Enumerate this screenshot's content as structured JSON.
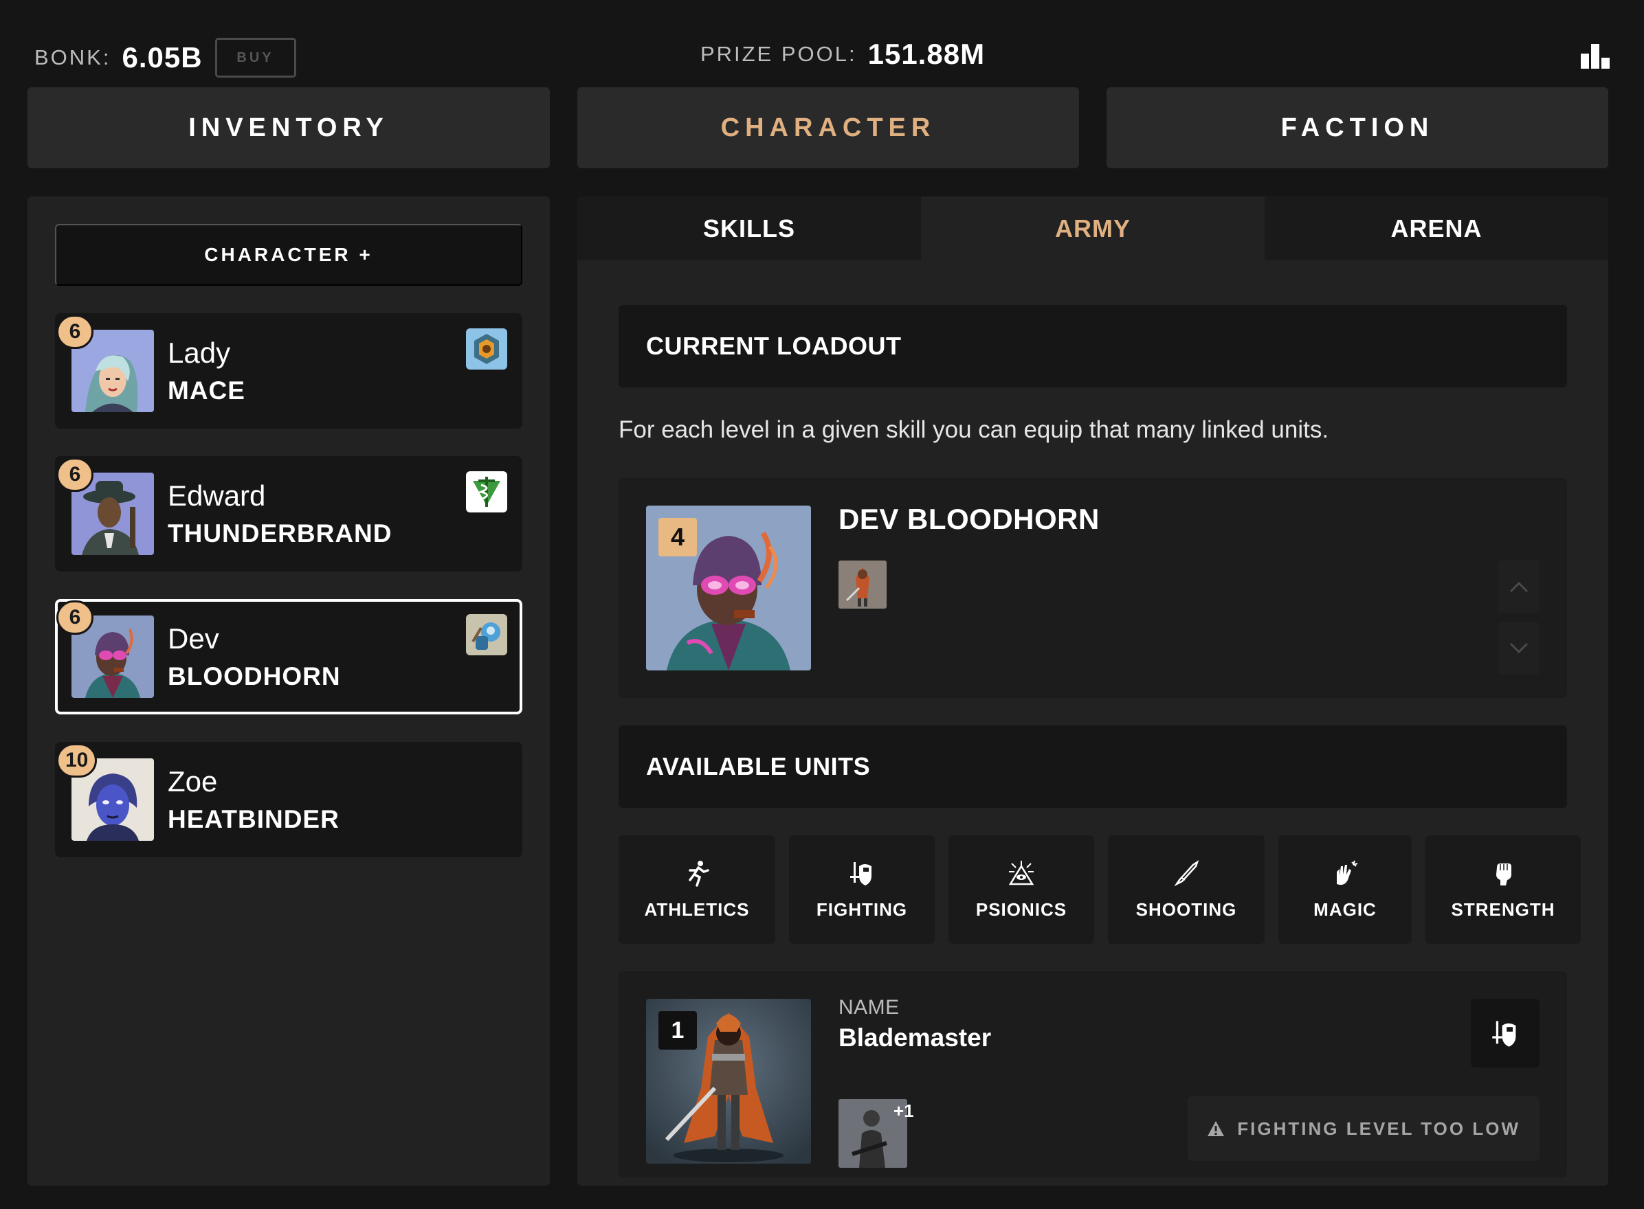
{
  "header": {
    "bonk_label": "BONK:",
    "bonk_value": "6.05B",
    "buy_label": "BUY",
    "prize_label": "PRIZE POOL:",
    "prize_value": "151.88M",
    "stats_icon": "bar-chart-icon"
  },
  "main_tabs": {
    "inventory": "INVENTORY",
    "character": "CHARACTER",
    "faction": "FACTION",
    "active": "CHARACTER"
  },
  "left": {
    "add_character_label": "CHARACTER +",
    "characters": [
      {
        "level": "6",
        "first": "Lady",
        "last": "MACE",
        "faction_icon": "hexagon-crest-icon",
        "selected": false
      },
      {
        "level": "6",
        "first": "Edward",
        "last": "THUNDERBRAND",
        "faction_icon": "green-caduceus-icon",
        "selected": false
      },
      {
        "level": "6",
        "first": "Dev",
        "last": "BLOODHORN",
        "faction_icon": "blue-robot-icon",
        "selected": true
      },
      {
        "level": "10",
        "first": "Zoe",
        "last": "HEATBINDER",
        "faction_icon": null,
        "selected": false
      }
    ]
  },
  "sub_tabs": {
    "skills": "SKILLS",
    "army": "ARMY",
    "arena": "ARENA",
    "active": "ARMY"
  },
  "loadout": {
    "header": "CURRENT LOADOUT",
    "description": "For each level in a given skill you can equip that many linked units.",
    "level": "4",
    "name": "DEV BLOODHORN",
    "up_icon": "chevron-up-icon",
    "down_icon": "chevron-down-icon"
  },
  "available": {
    "header": "AVAILABLE UNITS",
    "skills": [
      {
        "label": "ATHLETICS",
        "icon": "running-icon"
      },
      {
        "label": "FIGHTING",
        "icon": "sword-shield-icon"
      },
      {
        "label": "PSIONICS",
        "icon": "all-seeing-eye-icon"
      },
      {
        "label": "SHOOTING",
        "icon": "rifle-icon"
      },
      {
        "label": "MAGIC",
        "icon": "magic-hand-icon"
      },
      {
        "label": "STRENGTH",
        "icon": "fist-icon"
      }
    ],
    "unit": {
      "level": "1",
      "name_label": "NAME",
      "name": "Blademaster",
      "extra_count": "+1",
      "skill_icon": "sword-shield-icon",
      "warning": "FIGHTING LEVEL TOO LOW"
    }
  },
  "colors": {
    "background": "#151515",
    "panel": "#222222",
    "card": "#161616",
    "accent": "#e0b080",
    "badge": "#f0c08a"
  }
}
